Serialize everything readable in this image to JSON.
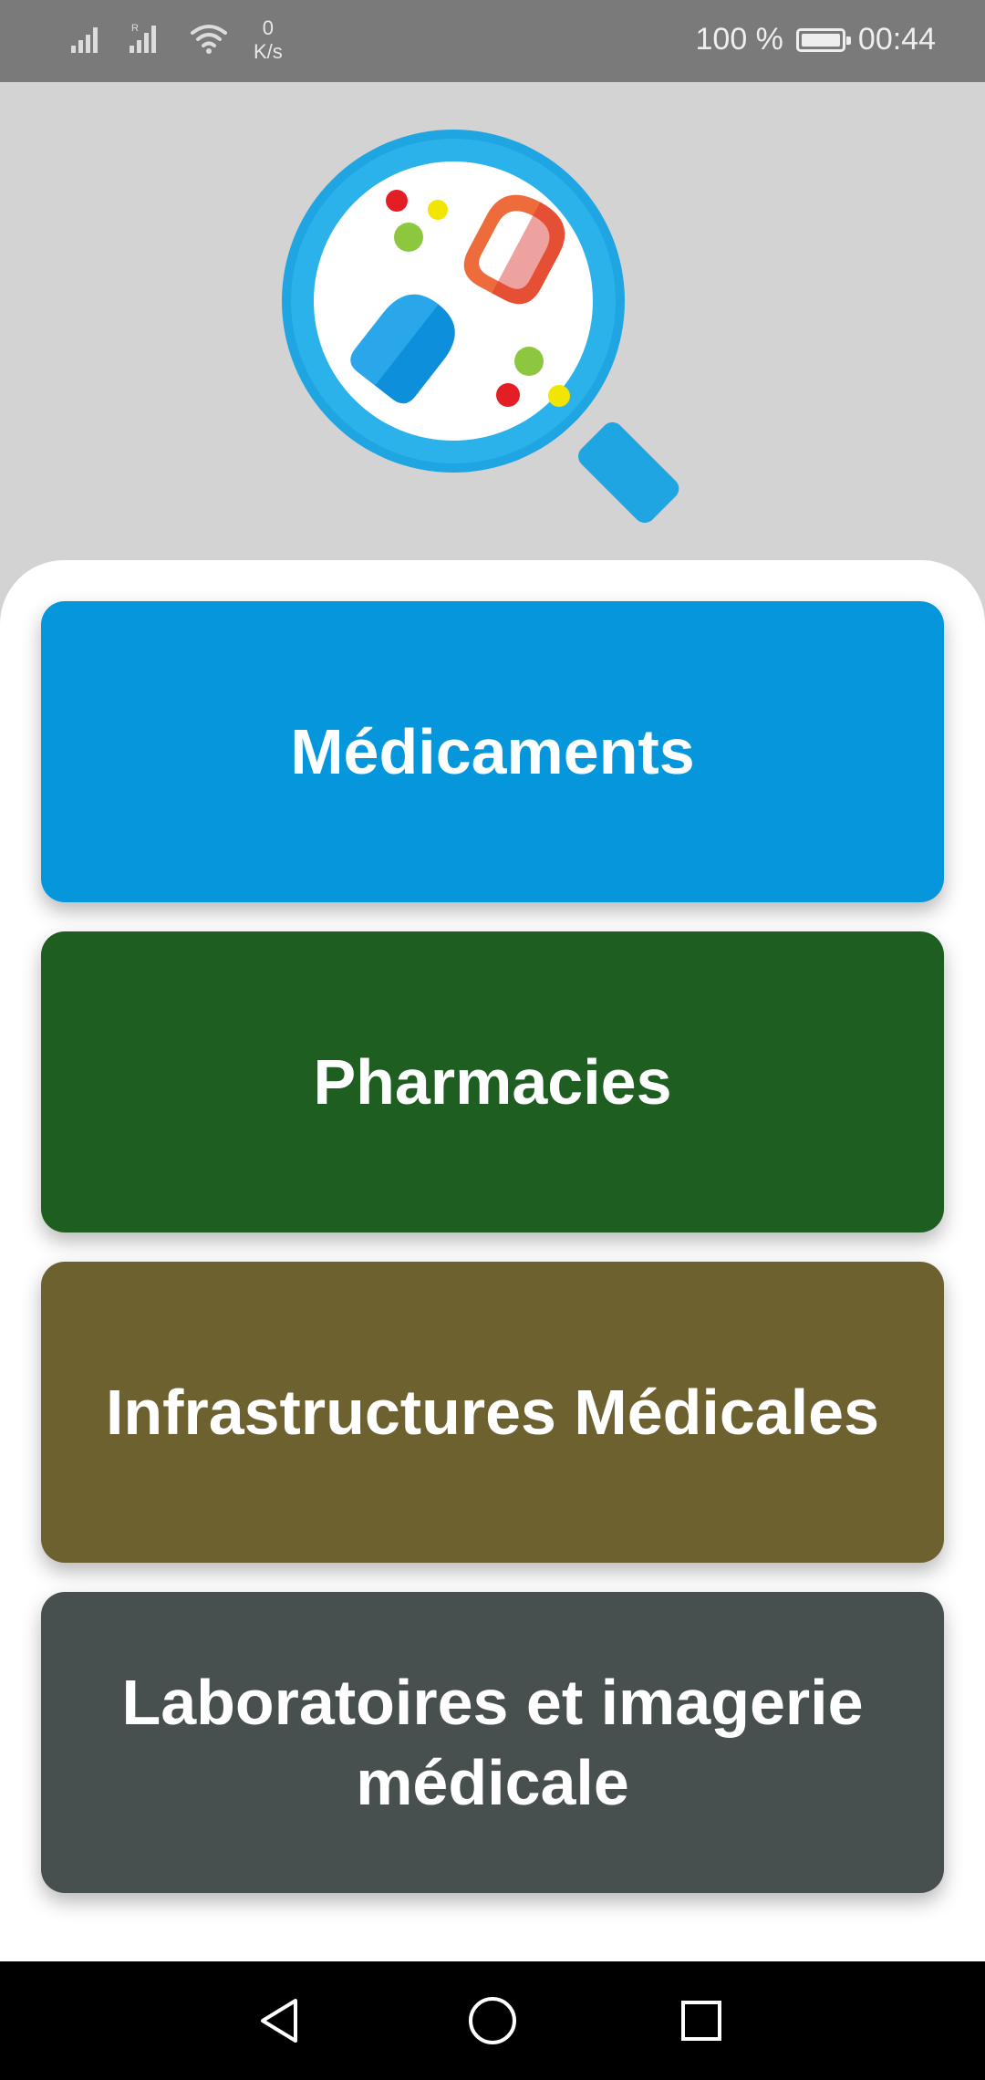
{
  "status_bar": {
    "net_speed_value": "0",
    "net_speed_unit": "K/s",
    "battery_percent": "100 %",
    "time": "00:44",
    "roaming_indicator": "R",
    "icons": [
      "signal-icon",
      "signal-roaming-icon",
      "wifi-icon",
      "battery-icon"
    ]
  },
  "logo": {
    "icon": "pill-magnifier-logo",
    "colors": {
      "ring": "#1ea5e2",
      "capsule_blue": "#0d8fdc",
      "capsule_red": "#e8452c",
      "dot_red": "#e31e24",
      "dot_green": "#8dc63f",
      "dot_yellow": "#f2e500"
    }
  },
  "menu": {
    "items": [
      {
        "label": "Médicaments",
        "color": "#0696dc"
      },
      {
        "label": "Pharmacies",
        "color": "#1e5e21"
      },
      {
        "label": "Infrastructures Médicales",
        "color": "#6e6130"
      },
      {
        "label": "Laboratoires et imagerie médicale",
        "color": "#474f4f"
      }
    ]
  },
  "nav_bar": {
    "icons": [
      "back-icon",
      "home-icon",
      "recents-icon"
    ]
  }
}
